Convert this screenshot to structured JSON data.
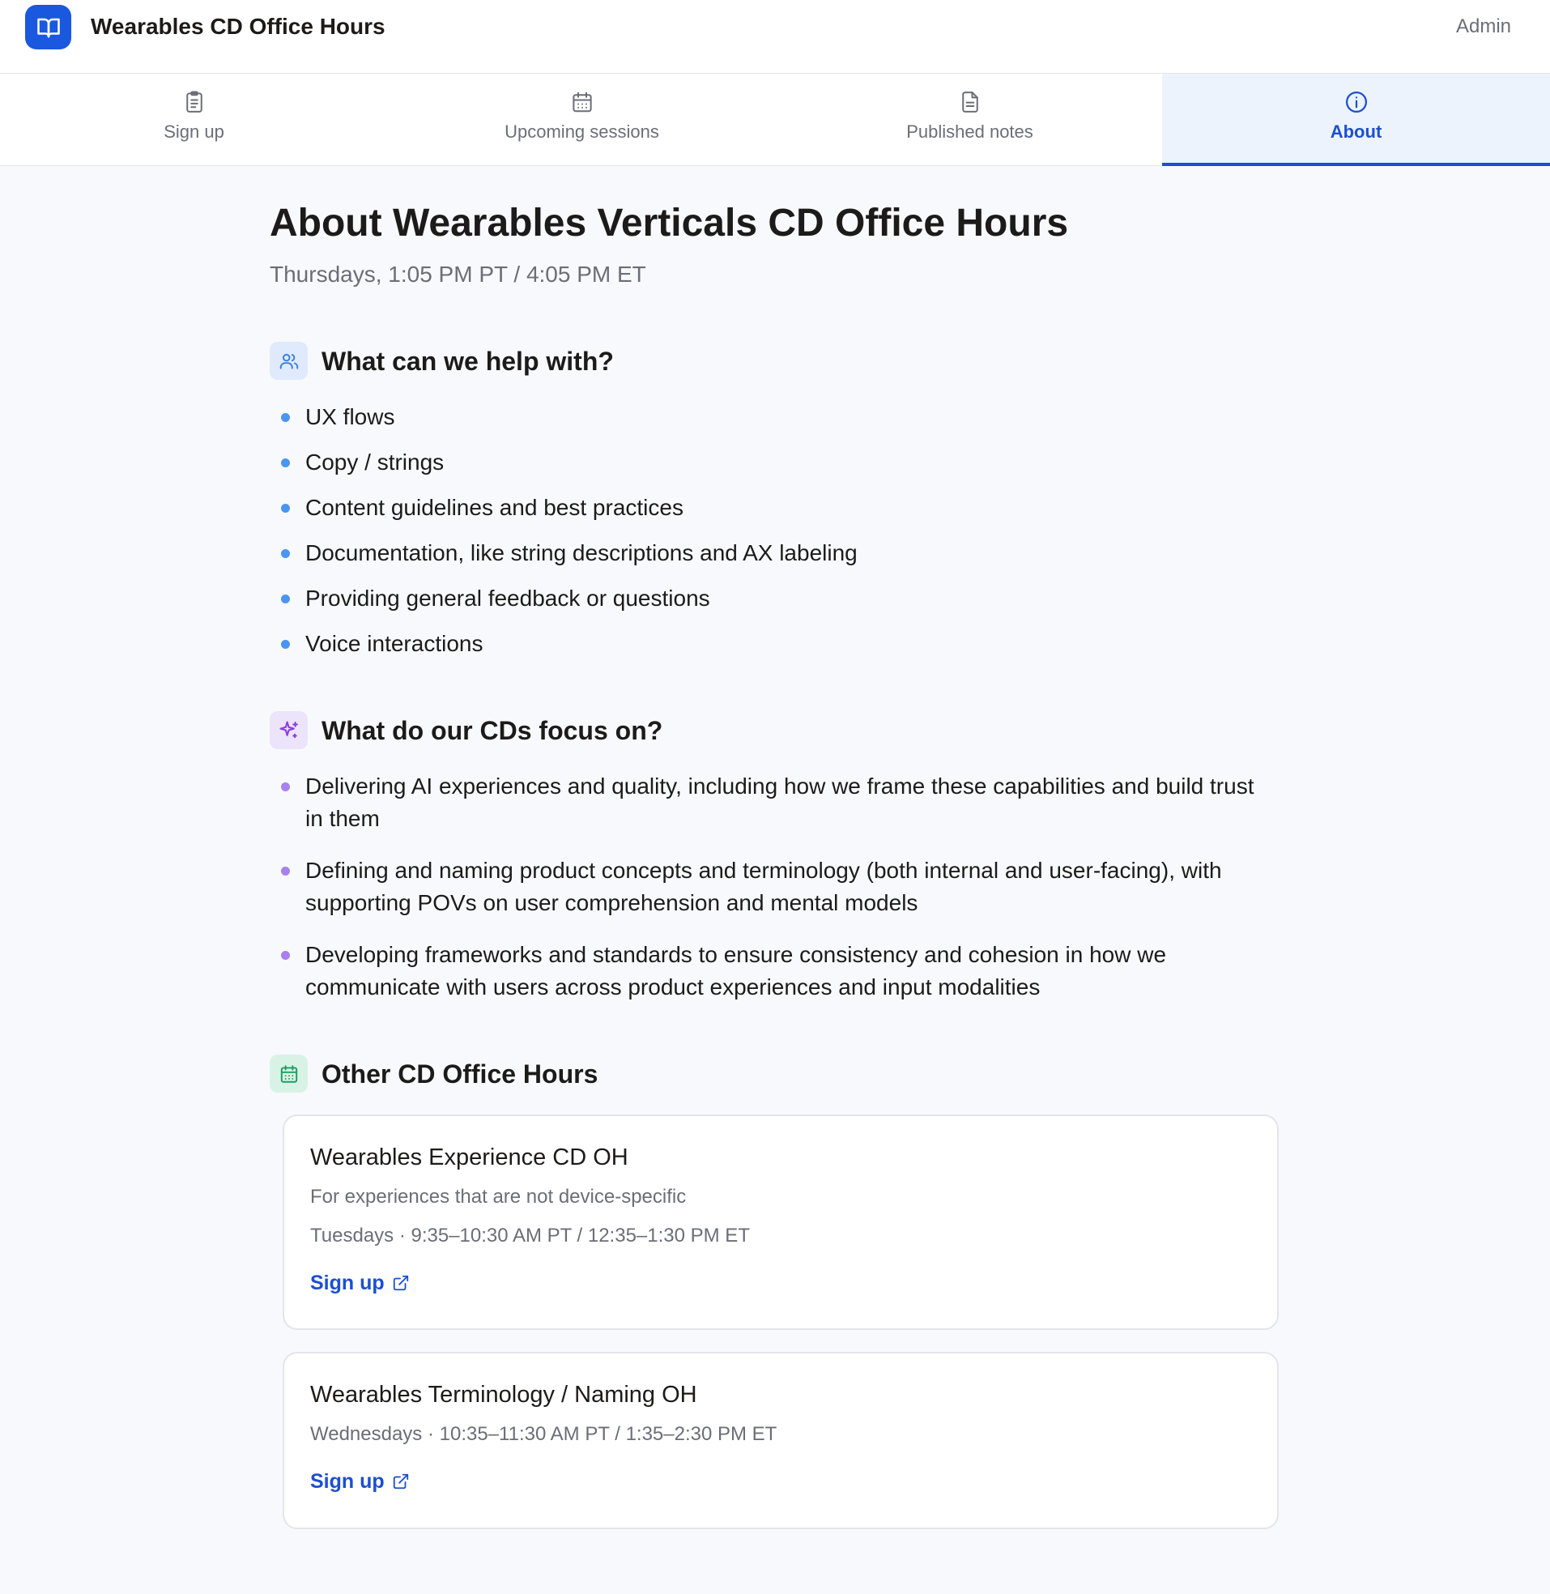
{
  "app": {
    "title": "Wearables CD Office Hours",
    "logo_icon": "book-open-icon",
    "admin_label": "Admin"
  },
  "tabs": [
    {
      "label": "Sign up",
      "icon": "clipboard-list-icon",
      "active": false
    },
    {
      "label": "Upcoming sessions",
      "icon": "calendar-icon",
      "active": false
    },
    {
      "label": "Published notes",
      "icon": "document-icon",
      "active": false
    },
    {
      "label": "About",
      "icon": "info-icon",
      "active": true
    }
  ],
  "about": {
    "title": "About Wearables Verticals CD Office Hours",
    "schedule": "Thursdays, 1:05 PM PT / 4:05 PM ET",
    "help": {
      "icon": "users-icon",
      "title": "What can we help with?",
      "items": [
        "UX flows",
        "Copy / strings",
        "Content guidelines and best practices",
        "Documentation, like string descriptions and AX labeling",
        "Providing general feedback or questions",
        "Voice interactions"
      ]
    },
    "focus": {
      "icon": "sparkles-icon",
      "title": "What do our CDs focus on?",
      "items": [
        "Delivering AI experiences and quality, including how we frame these capabilities and build trust in them",
        "Defining and naming product concepts and terminology (both internal and user-facing), with supporting POVs on user comprehension and mental models",
        "Developing frameworks and standards to ensure consistency and cohesion in how we communicate with users across product experiences and input modalities"
      ]
    },
    "other": {
      "icon": "calendar-icon",
      "title": "Other CD Office Hours",
      "cards": [
        {
          "title": "Wearables Experience CD OH",
          "description": "For experiences that are not device-specific",
          "schedule": "Tuesdays · 9:35–10:30 AM PT / 12:35–1:30 PM ET",
          "link_label": "Sign up",
          "link_icon": "external-link-icon"
        },
        {
          "title": "Wearables Terminology / Naming OH",
          "schedule": "Wednesdays · 10:35–11:30 AM PT / 1:35–2:30 PM ET",
          "link_label": "Sign up",
          "link_icon": "external-link-icon"
        }
      ]
    }
  },
  "colors": {
    "brand_blue": "#1a58e0",
    "link_blue": "#1c4fd0",
    "bullet_blue": "#4a95f0",
    "bullet_purple": "#a880ef",
    "icon_green": "#1f9b63",
    "page_background": "#f8f9fc"
  }
}
